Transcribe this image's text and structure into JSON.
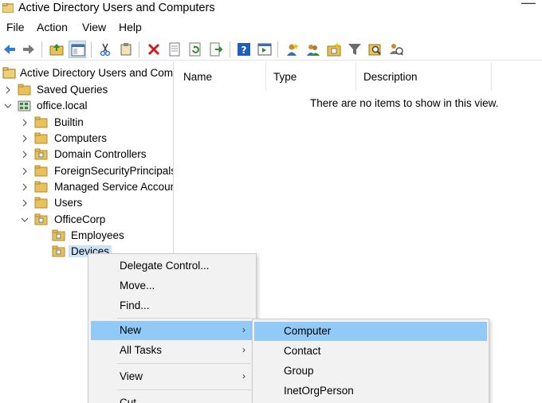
{
  "window": {
    "title": "Active Directory Users and Computers",
    "close_glyph": "—"
  },
  "menu": [
    "File",
    "Action",
    "View",
    "Help"
  ],
  "toolbar": {
    "icons": [
      "back-arrow-icon",
      "forward-arrow-icon",
      "up-folder-icon",
      "show-hide-console-tree-icon",
      "cut-icon",
      "copy-icon",
      "delete-icon",
      "properties-icon",
      "refresh-icon",
      "export-list-icon",
      "help-icon",
      "show-action-pane-icon",
      "new-user-icon",
      "new-group-icon",
      "new-ou-icon",
      "filter-icon",
      "find-icon",
      "delegate-icon"
    ]
  },
  "tree": {
    "root": "Active Directory Users and Com",
    "saved_queries": "Saved Queries",
    "domain": "office.local",
    "items": [
      "Builtin",
      "Computers",
      "Domain Controllers",
      "ForeignSecurityPrincipals",
      "Managed Service Accounts",
      "Users",
      "OfficeCorp"
    ],
    "ou_children": [
      "Employees",
      "Devices"
    ]
  },
  "list": {
    "columns": [
      "Name",
      "Type",
      "Description"
    ],
    "empty_message": "There are no items to show in this view."
  },
  "context_menu": {
    "items": [
      "Delegate Control...",
      "Move...",
      "Find...",
      "New",
      "All Tasks",
      "View",
      "Cut"
    ],
    "submenu_arrow": "›",
    "highlighted": "New"
  },
  "new_submenu": {
    "items": [
      "Computer",
      "Contact",
      "Group",
      "InetOrgPerson"
    ],
    "highlighted": "Computer"
  },
  "colors": {
    "highlight": "#91c9f7",
    "tree_selection": "#cce4f7",
    "menu_background": "#f2f2f2",
    "folder_yellow": "#e8c15a"
  }
}
